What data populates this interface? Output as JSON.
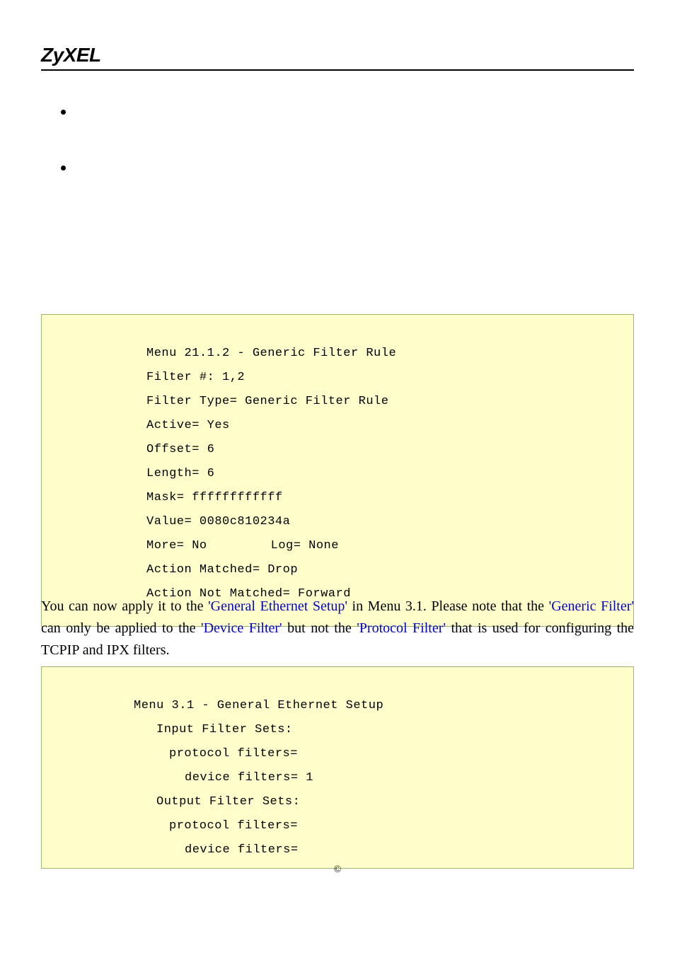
{
  "header": {
    "logo": "ZyXEL"
  },
  "codebox1": {
    "line1": "Menu 21.1.2 - Generic Filter Rule",
    "line2": "Filter #: 1,2",
    "line3": "Filter Type= Generic Filter Rule",
    "line4": "Active= Yes",
    "line5": "Offset= 6",
    "line6": "Length= 6",
    "line7": "Mask= ffffffffffff",
    "line8": "Value= 0080c810234a",
    "line9a": "More= No",
    "line9b": "Log= None",
    "line10": "Action Matched= Drop",
    "line11": "Action Not Matched= Forward"
  },
  "body": {
    "part1": "You can now apply it to the ",
    "link1": "'General Ethernet Setup'",
    "part2": " in Menu 3.1. Please note that the ",
    "link2": "'Generic Filter'",
    "part3": " can only be applied to the ",
    "link3": "'Device Filter'",
    "part4": " but not the ",
    "link4": "'Protocol Filter'",
    "part5": " that is used for configuring the TCPIP and IPX filters."
  },
  "codebox2": {
    "line1": "Menu 3.1 - General Ethernet Setup",
    "line2": "Input Filter Sets:",
    "line3": "protocol filters=",
    "line4": "device filters= 1",
    "line5": "Output Filter Sets:",
    "line6": "protocol filters=",
    "line7": "device filters="
  },
  "footer": {
    "copyright": "©"
  }
}
